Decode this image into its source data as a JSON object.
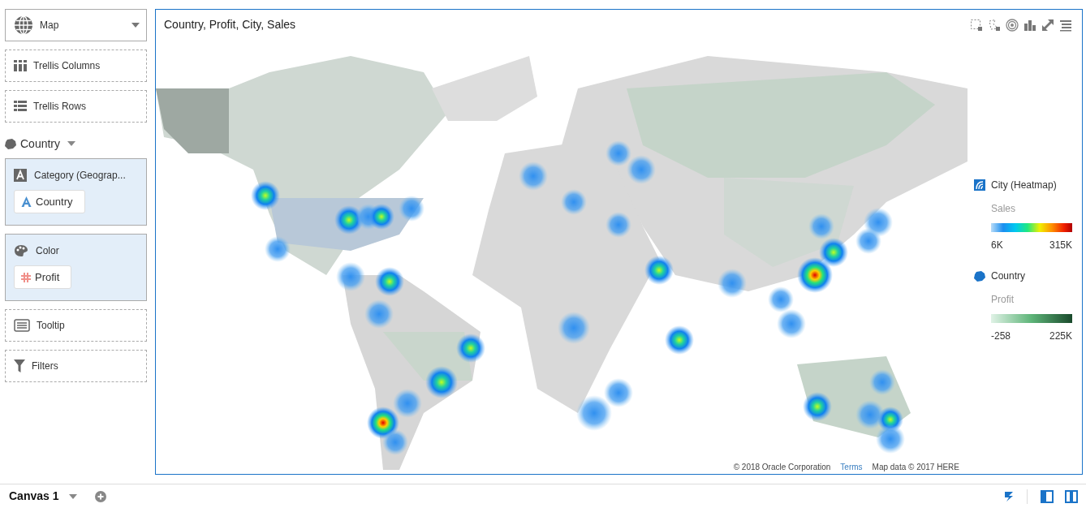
{
  "chart_type": {
    "label": "Map"
  },
  "drop_targets": [
    {
      "kind": "columns",
      "label": "Trellis Columns"
    },
    {
      "kind": "rows",
      "label": "Trellis Rows"
    }
  ],
  "layer": {
    "label": "Country"
  },
  "sections": [
    {
      "kind": "category",
      "label": "Category (Geograp...",
      "chip": {
        "kind": "attribute",
        "label": "Country"
      }
    },
    {
      "kind": "color",
      "label": "Color",
      "chip": {
        "kind": "measure",
        "label": "Profit"
      }
    }
  ],
  "bottom_targets": [
    {
      "kind": "tooltip",
      "label": "Tooltip"
    },
    {
      "kind": "filters",
      "label": "Filters"
    }
  ],
  "viz": {
    "title": "Country, Profit, City, Sales",
    "legend": [
      {
        "kind": "heatmap",
        "title": "City (Heatmap)",
        "measure": "Sales",
        "min": "6K",
        "max": "315K"
      },
      {
        "kind": "area",
        "title": "Country",
        "measure": "Profit",
        "min": "-258",
        "max": "225K"
      }
    ],
    "attribution": {
      "copyright": "© 2018 Oracle Corporation",
      "link": "Terms",
      "map_data": "Map data © 2017 HERE"
    }
  },
  "canvas_tab": {
    "label": "Canvas 1"
  }
}
